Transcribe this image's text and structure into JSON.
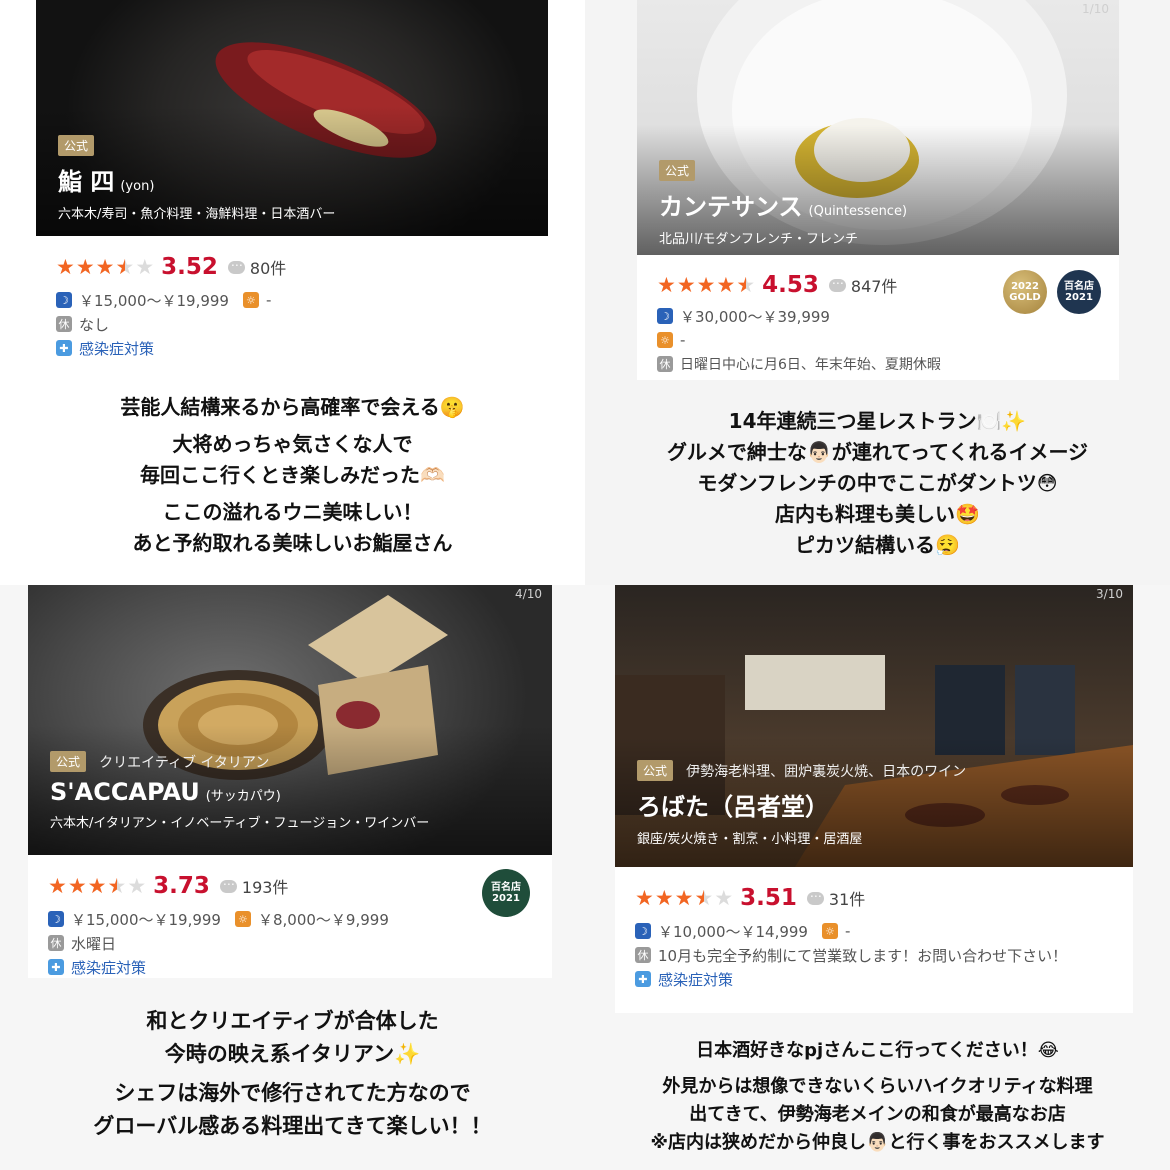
{
  "cards": [
    {
      "official_label": "公式",
      "cuisine": "",
      "name": "鮨 四",
      "name_sub": "(yon)",
      "genre": "六本木/寿司・魚介料理・海鮮料理・日本酒バー",
      "pager": "",
      "rating": 3.52,
      "score": "3.52",
      "reviews": "80件",
      "dinner_price": "￥15,000〜￥19,999",
      "lunch_price": "-",
      "holiday": "なし",
      "covid": "感染症対策",
      "badges": [],
      "caption": [
        "芸能人結構来るから高確率で会える🤫",
        "大将めっちゃ気さくな人で",
        "毎回ここ行くとき楽しみだった🫶🏻",
        "ここの溢れるウニ美味しい！",
        "あと予約取れる美味しいお鮨屋さん"
      ]
    },
    {
      "official_label": "公式",
      "cuisine": "",
      "name": "カンテサンス",
      "name_sub": "(Quintessence)",
      "genre": "北品川/モダンフレンチ・フレンチ",
      "pager": "1/10",
      "rating": 4.53,
      "score": "4.53",
      "reviews": "847件",
      "dinner_price": "￥30,000〜￥39,999",
      "lunch_price": "-",
      "holiday": "日曜日中心に月6日、年末年始、夏期休暇",
      "covid": "",
      "badges": [
        {
          "kind": "gold",
          "line1": "2022",
          "line2": "GOLD"
        },
        {
          "kind": "navy",
          "line1": "百名店",
          "line2": "2021"
        }
      ],
      "caption": [
        "14年連続三つ星レストラン🍽️✨",
        "グルメで紳士な👨🏻が連れてってくれるイメージ",
        "モダンフレンチの中でここがダントツ😳",
        "店内も料理も美しい🤩",
        "ピカツ結構いる😮‍💨"
      ]
    },
    {
      "official_label": "公式",
      "cuisine": "クリエイティブ イタリアン",
      "name": "S'ACCAPAU",
      "name_sub": "(サッカパウ)",
      "genre": "六本木/イタリアン・イノベーティブ・フュージョン・ワインバー",
      "pager": "4/10",
      "rating": 3.73,
      "score": "3.73",
      "reviews": "193件",
      "dinner_price": "￥15,000〜￥19,999",
      "lunch_price": "￥8,000〜￥9,999",
      "holiday": "水曜日",
      "covid": "感染症対策",
      "badges": [
        {
          "kind": "green",
          "line1": "百名店",
          "line2": "2021"
        }
      ],
      "caption": [
        "和とクリエイティブが合体した",
        "今時の映え系イタリアン✨",
        "シェフは海外で修行されてた方なので",
        "グローバル感ある料理出てきて楽しい！！"
      ]
    },
    {
      "official_label": "公式",
      "cuisine": "伊勢海老料理、囲炉裏炭火焼、日本のワイン",
      "name": "ろばた（呂者堂）",
      "name_sub": "",
      "genre": "銀座/炭火焼き・割烹・小料理・居酒屋",
      "pager": "3/10",
      "rating": 3.51,
      "score": "3.51",
      "reviews": "31件",
      "dinner_price": "￥10,000〜￥14,999",
      "lunch_price": "-",
      "holiday": "10月も完全予約制にて営業致します！お問い合わせ下さい！",
      "covid": "感染症対策",
      "badges": [],
      "caption": [
        "日本酒好きなpjさんここ行ってください！😂",
        "外見からは想像できないくらいハイクオリティな料理",
        "出てきて、伊勢海老メインの和食が最高なお店",
        "※店内は狭めだから仲良し👨🏻と行く事をおススメします"
      ]
    }
  ],
  "icons": {
    "dinner": "moon-icon",
    "lunch": "sun-icon",
    "holiday": "holiday-icon",
    "covid": "shield-icon",
    "reviews": "comment-icon"
  },
  "colors": {
    "star": "#f26522",
    "score": "#c8102e",
    "official": "#b29a6a",
    "link": "#2a62b8"
  }
}
